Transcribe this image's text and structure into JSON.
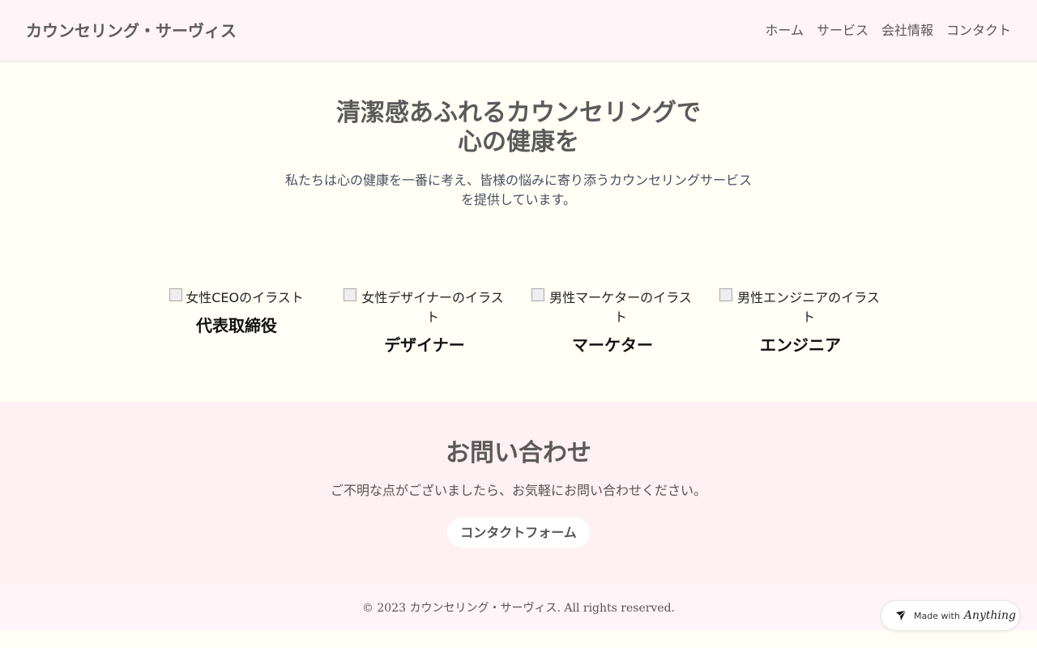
{
  "header": {
    "logo": "カウンセリング・サーヴィス",
    "nav": [
      "ホーム",
      "サービス",
      "会社情報",
      "コンタクト"
    ]
  },
  "hero": {
    "title_line1": "清潔感あふれるカウンセリングで",
    "title_line2": "心の健康を",
    "subtitle": "私たちは心の健康を一番に考え、皆様の悩みに寄り添うカウンセリングサービスを提供しています。"
  },
  "team": [
    {
      "alt": "女性CEOのイラスト",
      "role": "代表取締役"
    },
    {
      "alt": "女性デザイナーのイラスト",
      "role": "デザイナー"
    },
    {
      "alt": "男性マーケターのイラスト",
      "role": "マーケター"
    },
    {
      "alt": "男性エンジニアのイラスト",
      "role": "エンジニア"
    }
  ],
  "contact": {
    "title": "お問い合わせ",
    "text": "ご不明な点がございましたら、お気軽にお問い合わせください。",
    "button": "コンタクトフォーム"
  },
  "footer": {
    "copyright": "© 2023 カウンセリング・サーヴィス. All rights reserved."
  },
  "badge": {
    "made_with": "Made with",
    "brand": "Anything"
  },
  "colors": {
    "page_bg": "#fffff5",
    "header_bg": "#fff4f8",
    "contact_bg": "#fff0f3"
  }
}
